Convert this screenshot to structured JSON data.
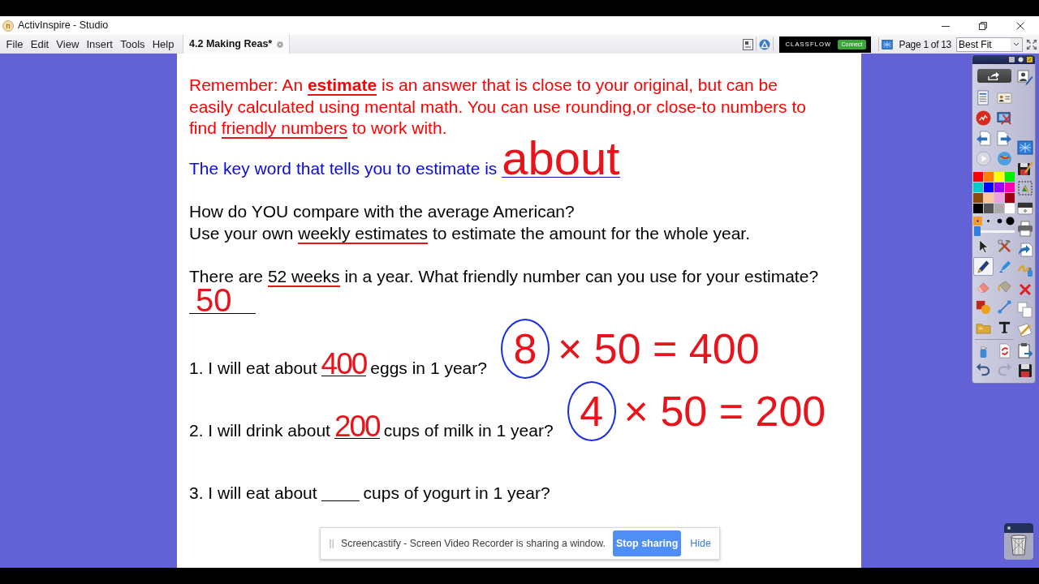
{
  "window": {
    "title": "ActivInspire - Studio"
  },
  "menu": [
    "File",
    "Edit",
    "View",
    "Insert",
    "Tools",
    "Help"
  ],
  "tabs": [
    {
      "label": "4.2 Making Reas*",
      "selected": true
    }
  ],
  "toolbar": {
    "classflow": {
      "logo": "CLASSFLOW",
      "button": "Connect"
    },
    "page_indicator": "Page 1 of 13",
    "zoom": {
      "value": "Best Fit"
    }
  },
  "flipchart": {
    "blocks": [
      {
        "kind": "paragraph",
        "color": "#ff0000",
        "lines": [
          [
            {
              "text": "Remember: An ",
              "ink_underline": false
            },
            {
              "text": "**estimate**",
              "ink_underline": true
            },
            {
              "text": " is an answer that is close to your original, but can be",
              "ink_underline": false
            }
          ],
          [
            {
              "text": "easily calculated using mental math. You can use rounding,or close-to numbers to",
              "ink_underline": false
            }
          ],
          [
            {
              "text": "find ",
              "ink_underline": false
            },
            {
              "text": "friendly numbers",
              "ink_underline": true
            },
            {
              "text": " to work with.",
              "ink_underline": false
            }
          ]
        ]
      },
      {
        "kind": "fill_in",
        "color": "#0c0cd0",
        "prompt": "The key word that tells you to estimate is",
        "answer": "about"
      },
      {
        "kind": "paragraph",
        "color": "#000000",
        "lines": [
          [
            {
              "text": "How do YOU compare with the average American?",
              "ink_underline": false
            }
          ],
          [
            {
              "text": "Use your own ",
              "ink_underline": false
            },
            {
              "text": "weekly estimates",
              "ink_underline": true
            },
            {
              "text": " to estimate the amount for the whole year.",
              "ink_underline": false
            }
          ]
        ]
      },
      {
        "kind": "paragraph",
        "color": "#000000",
        "lines": [
          [
            {
              "text": "There are ",
              "ink_underline": false
            },
            {
              "text": "52 weeks",
              "ink_underline": true
            },
            {
              "text": " in a year. What friendly number can you use for your estimate?",
              "ink_underline": false
            }
          ]
        ]
      },
      {
        "kind": "answer_line",
        "color": "#000000",
        "answer": "50"
      },
      {
        "kind": "question",
        "color": "#000000",
        "prompt": "1. I will eat about",
        "answer": "400",
        "suffix": "eggs in 1 year?",
        "work": {
          "circled": "8",
          "rest": "× 50 = 400"
        }
      },
      {
        "kind": "question",
        "color": "#000000",
        "prompt": "2. I will drink about",
        "answer": "200",
        "suffix": "cups of milk in 1 year?",
        "work": {
          "circled": "4",
          "rest": "× 50 = 200"
        }
      },
      {
        "kind": "question",
        "color": "#000000",
        "prompt": "3. I will eat about",
        "suffix": "cups of yogurt in 1 year?"
      }
    ]
  },
  "toolbox": {
    "palette": [
      {
        "color": "#ff0000"
      },
      {
        "color": "#ff8000"
      },
      {
        "color": "#ffff00"
      },
      {
        "color": "#00ee00"
      },
      {
        "color": "#00cccc"
      },
      {
        "color": "#0000ff"
      },
      {
        "color": "#9900ff"
      },
      {
        "color": "#ff00aa"
      },
      {
        "color": "#8b4a0c"
      },
      {
        "color": "#f8c89c"
      },
      {
        "color": "#f0a0dc"
      },
      {
        "color": "#a00014"
      },
      {
        "color": "#000000"
      },
      {
        "color": "#555555"
      },
      {
        "color": "#aaaaaa"
      },
      {
        "color": "#ffffff"
      }
    ],
    "pen_widths": [
      {
        "selected": true
      },
      {
        "selected": false
      },
      {
        "selected": false
      },
      {
        "selected": false
      }
    ],
    "thickness": {
      "level": 0
    },
    "tools": [
      {
        "selected": false
      },
      {
        "selected": false
      },
      {
        "selected": true
      },
      {
        "selected": false
      },
      {
        "selected": false
      },
      {
        "selected": false
      },
      {
        "selected": false
      },
      {
        "selected": false
      },
      {
        "selected": false
      },
      {
        "selected": false
      }
    ],
    "history": [
      {
        "disabled": false
      },
      {
        "disabled": true
      }
    ]
  },
  "sharing_bar": {
    "message": "Screencastify - Screen Video Recorder is sharing a window.",
    "stop_button": "Stop sharing",
    "hide_link": "Hide"
  }
}
